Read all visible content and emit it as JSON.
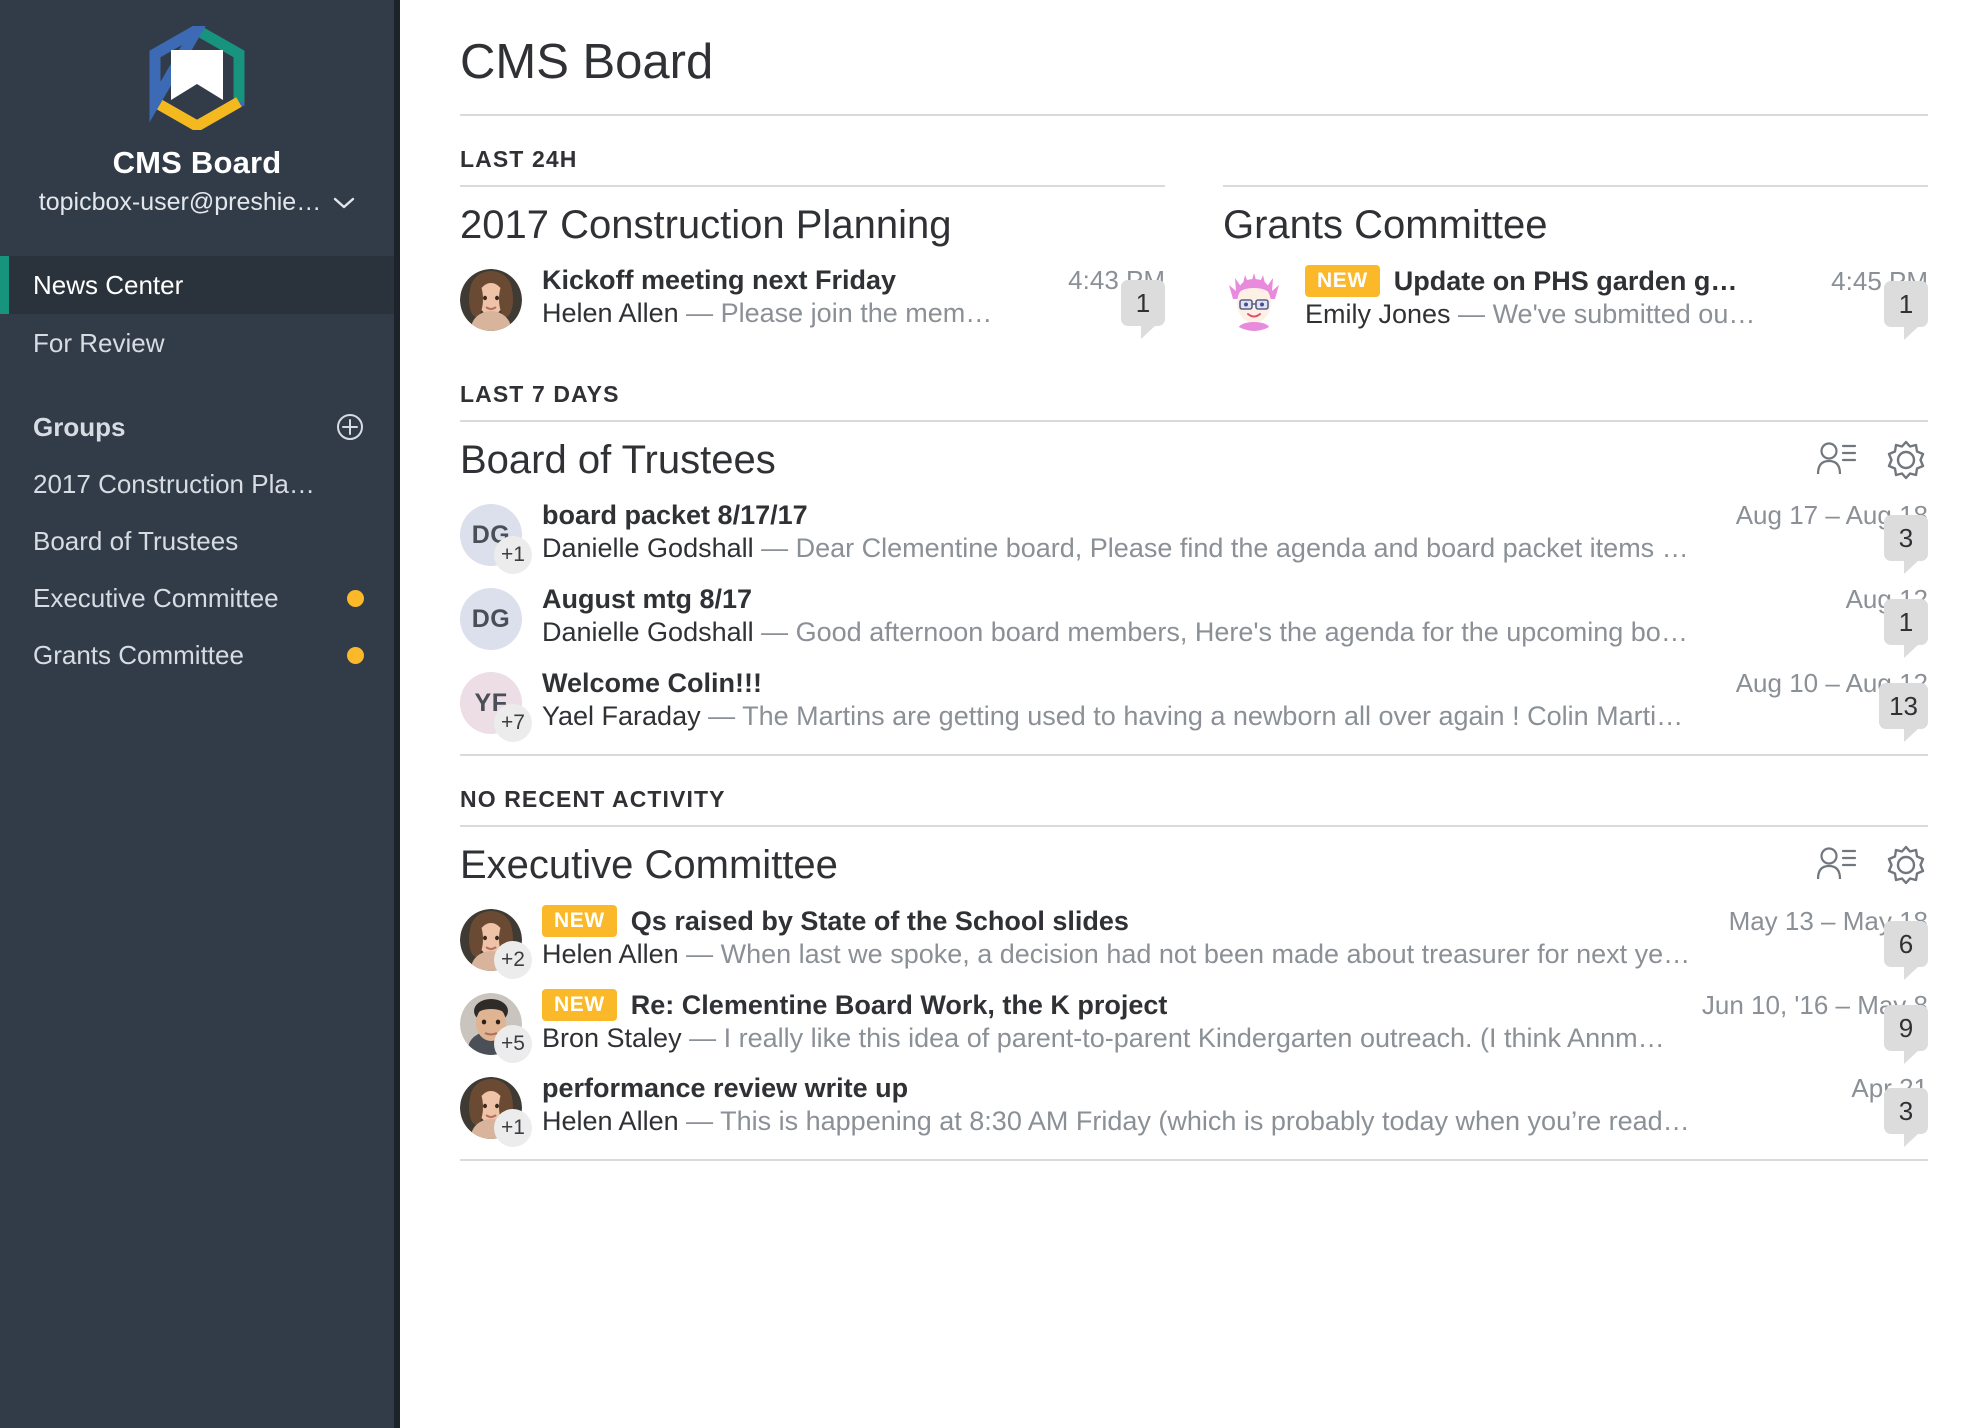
{
  "sidebar": {
    "logo_icon": "topicbox-hexagon-logo",
    "brand_name": "CMS Board",
    "account_email": "topicbox-user@preshie…",
    "account_chevron_icon": "chevron-down-icon",
    "nav": [
      {
        "label": "News Center",
        "active": true
      },
      {
        "label": "For Review",
        "active": false
      }
    ],
    "groups_section": {
      "label": "Groups",
      "add_icon": "plus-circle-icon",
      "items": [
        {
          "label": "2017 Construction Pla…",
          "unread": false
        },
        {
          "label": "Board of Trustees",
          "unread": false
        },
        {
          "label": "Executive Committee",
          "unread": true
        },
        {
          "label": "Grants Committee",
          "unread": true
        }
      ]
    }
  },
  "main": {
    "page_title": "CMS Board",
    "sections": [
      {
        "label": "LAST 24H",
        "layout": "two-column",
        "groups": [
          {
            "title": "2017 Construction Planning",
            "show_actions": false,
            "threads": [
              {
                "avatar_type": "photo-woman-brown-hair",
                "initials": "",
                "plus": "",
                "new": false,
                "subject": "Kickoff meeting next Friday",
                "date": "4:43 PM",
                "author": "Helen Allen",
                "snippet": "Please join the mem…",
                "count": "1"
              }
            ]
          },
          {
            "title": "Grants Committee",
            "show_actions": false,
            "threads": [
              {
                "avatar_type": "cartoon-pink-hair-glasses",
                "initials": "",
                "plus": "",
                "new": true,
                "new_label": "NEW",
                "subject": "Update on PHS garden g…",
                "date": "4:45 PM",
                "author": "Emily Jones",
                "snippet": "We've submitted ou…",
                "count": "1"
              }
            ]
          }
        ]
      },
      {
        "label": "LAST 7 DAYS",
        "layout": "full",
        "groups": [
          {
            "title": "Board of Trustees",
            "show_actions": true,
            "members_icon": "members-icon",
            "settings_icon": "gear-icon",
            "threads": [
              {
                "avatar_type": "initials",
                "initials": "DG",
                "avatar_color": "#dcdfec",
                "plus": "+1",
                "new": false,
                "subject": "board packet 8/17/17",
                "date": "Aug 17 – Aug 18",
                "author": "Danielle Godshall",
                "snippet": "Dear Clementine board, Please find the agenda and board packet items …",
                "count": "3"
              },
              {
                "avatar_type": "initials",
                "initials": "DG",
                "avatar_color": "#dcdfec",
                "plus": "",
                "new": false,
                "subject": "August mtg 8/17",
                "date": "Aug 12",
                "author": "Danielle Godshall",
                "snippet": "Good afternoon board members, Here's the agenda for the upcoming bo…",
                "count": "1"
              },
              {
                "avatar_type": "initials",
                "initials": "YF",
                "avatar_color": "#ecdee4",
                "plus": "+7",
                "new": false,
                "subject": "Welcome Colin!!!",
                "date": "Aug 10 – Aug 12",
                "author": "Yael Faraday",
                "snippet": "The Martins are getting used to having a newborn all over again ! Colin Marti…",
                "count": "13"
              }
            ]
          }
        ]
      },
      {
        "label": "NO RECENT ACTIVITY",
        "layout": "full",
        "groups": [
          {
            "title": "Executive Committee",
            "show_actions": true,
            "members_icon": "members-icon",
            "settings_icon": "gear-icon",
            "threads": [
              {
                "avatar_type": "photo-woman-brown-hair",
                "initials": "",
                "plus": "+2",
                "new": true,
                "new_label": "NEW",
                "subject": "Qs raised by State of the School slides",
                "date": "May 13 – May 18",
                "author": "Helen Allen",
                "snippet": "When last we spoke, a decision had not been made about treasurer for next ye…",
                "count": "6"
              },
              {
                "avatar_type": "photo-man",
                "initials": "",
                "plus": "+5",
                "new": true,
                "new_label": "NEW",
                "subject": "Re: Clementine Board Work, the K project",
                "date": "Jun 10, '16 – May 8",
                "author": "Bron Staley",
                "snippet": "I really like this idea of parent-to-parent Kindergarten outreach. (I think Annm…",
                "count": "9"
              },
              {
                "avatar_type": "photo-woman-brown-hair",
                "initials": "",
                "plus": "+1",
                "new": false,
                "subject": "performance review write up",
                "date": "Apr 21",
                "author": "Helen Allen",
                "snippet": "This is happening at 8:30 AM Friday (which is probably today when you’re read…",
                "count": "3"
              }
            ]
          }
        ]
      }
    ]
  },
  "colors": {
    "sidebar_bg": "#323c48",
    "sidebar_active_bg": "#2a323c",
    "accent_teal": "#17937e",
    "unread_amber": "#fbb829",
    "new_badge": "#fbb829",
    "text_dark": "#2f3135",
    "text_muted": "#8b9096",
    "divider": "#d8dade",
    "count_bubble": "#dcdcdc"
  }
}
